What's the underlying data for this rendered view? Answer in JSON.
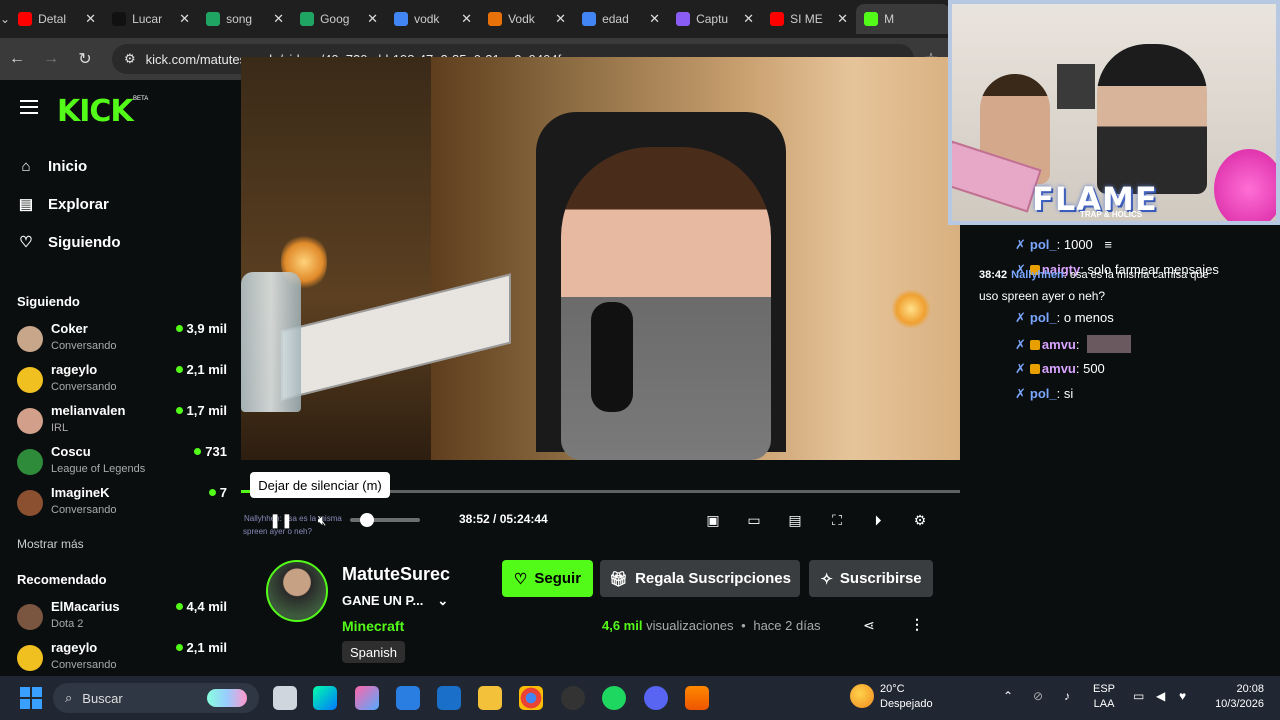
{
  "browser": {
    "tabs": [
      {
        "title": "Detal",
        "color": "#ff0000"
      },
      {
        "title": "Lucar",
        "color": "#111111"
      },
      {
        "title": "song",
        "color": "#1fa463"
      },
      {
        "title": "Goog",
        "color": "#1fa463"
      },
      {
        "title": "vodk",
        "color": "#4285f4"
      },
      {
        "title": "Vodk",
        "color": "#e8710a"
      },
      {
        "title": "edad",
        "color": "#4285f4"
      },
      {
        "title": "Captu",
        "color": "#8a5cf6"
      },
      {
        "title": "SI ME",
        "color": "#ff0000"
      },
      {
        "title": "M",
        "color": "#53fc18"
      }
    ],
    "url": "kick.com/matutesureda/videos/40a720cd-b198-47a2-85a0-31ee2e9404fc"
  },
  "header": {
    "logo": "KICK",
    "beta": "BETA",
    "search_placeholder": "Buscar"
  },
  "sidebar": {
    "nav": [
      {
        "label": "Inicio",
        "icon": "home-icon"
      },
      {
        "label": "Explorar",
        "icon": "browse-icon"
      },
      {
        "label": "Siguiendo",
        "icon": "heart-icon"
      }
    ],
    "following_title": "Siguiendo",
    "following": [
      {
        "name": "Coker",
        "game": "Conversando",
        "viewers": "3,9 mil",
        "color": "#c8a68a"
      },
      {
        "name": "rageylo",
        "game": "Conversando",
        "viewers": "2,1 mil",
        "color": "#f0c020"
      },
      {
        "name": "melianvalen",
        "game": "IRL",
        "viewers": "1,7 mil",
        "color": "#d2a08a"
      },
      {
        "name": "Coscu",
        "game": "League of Legends",
        "viewers": "731",
        "color": "#2e8b3a"
      },
      {
        "name": "ImagineK",
        "game": "Conversando",
        "viewers": "7",
        "color": "#8a5030"
      }
    ],
    "more": "Mostrar más",
    "recommended_title": "Recomendado",
    "recommended": [
      {
        "name": "ElMacarius",
        "game": "Dota 2",
        "viewers": "4,4 mil",
        "color": "#7a5540"
      },
      {
        "name": "rageylo",
        "game": "Conversando",
        "viewers": "2,1 mil",
        "color": "#f0c020"
      }
    ]
  },
  "player": {
    "tooltip": "Dejar de silenciar (m)",
    "time": "38:52 / 05:24:44",
    "progress": 0.12,
    "overlay_line1": "Nallyhhen: esa es la misma",
    "overlay_line2": "spreen ayer o neh?"
  },
  "channel": {
    "name": "MatuteSurec",
    "title": "GANE UN P...",
    "category": "Minecraft",
    "language": "Spanish",
    "follow": "Seguir",
    "gift": "Regala Suscripciones",
    "subscribe": "Suscribirse",
    "views_count": "4,6 mil",
    "views_label": "visualizaciones",
    "age": "hace 2 días",
    "accent": "#53fc18"
  },
  "overlay": {
    "flame": "FLAME",
    "flame_sub": "TRAP & HOLICS"
  },
  "chat": {
    "lines": [
      {
        "user": "pol_",
        "text": ": 1000"
      },
      {
        "user": "naigty",
        "text": ": solo farmear mensajes"
      },
      {
        "time": "38:42",
        "user": "Nallyhhen",
        "text": ": esa es la misma camisa que",
        "cont": "uso spreen ayer o neh?"
      },
      {
        "user": "pol_",
        "text": ": o menos"
      },
      {
        "user": "amvu",
        "text": ":"
      },
      {
        "user": "amvu",
        "text": ": 500"
      },
      {
        "user": "pol_",
        "text": ": si"
      }
    ]
  },
  "taskbar": {
    "search": "Buscar",
    "weather_temp": "20°C",
    "weather_desc": "Despejado",
    "lang1": "ESP",
    "lang2": "LAA",
    "time": "20:08",
    "date": "10/3/2026"
  }
}
